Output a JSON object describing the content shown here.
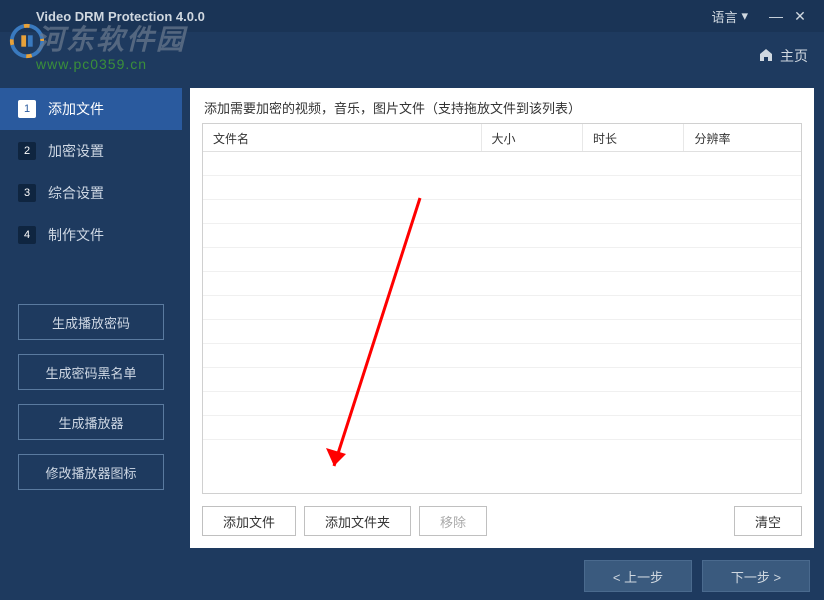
{
  "title": "Video DRM Protection 4.0.0",
  "watermark": {
    "main": "河东软件园",
    "url": "www.pc0359.cn"
  },
  "titlebar": {
    "language": "语言"
  },
  "home_label": "主页",
  "steps": [
    {
      "num": "1",
      "label": "添加文件"
    },
    {
      "num": "2",
      "label": "加密设置"
    },
    {
      "num": "3",
      "label": "综合设置"
    },
    {
      "num": "4",
      "label": "制作文件"
    }
  ],
  "side_buttons": [
    "生成播放密码",
    "生成密码黑名单",
    "生成播放器",
    "修改播放器图标"
  ],
  "content": {
    "hint": "添加需要加密的视频，音乐，图片文件（支持拖放文件到该列表）",
    "columns": {
      "name": "文件名",
      "size": "大小",
      "duration": "时长",
      "resolution": "分辨率"
    },
    "rows": []
  },
  "actions": {
    "add_file": "添加文件",
    "add_folder": "添加文件夹",
    "remove": "移除",
    "clear": "清空"
  },
  "nav": {
    "prev": "< 上一步",
    "next": "下一步 >"
  }
}
